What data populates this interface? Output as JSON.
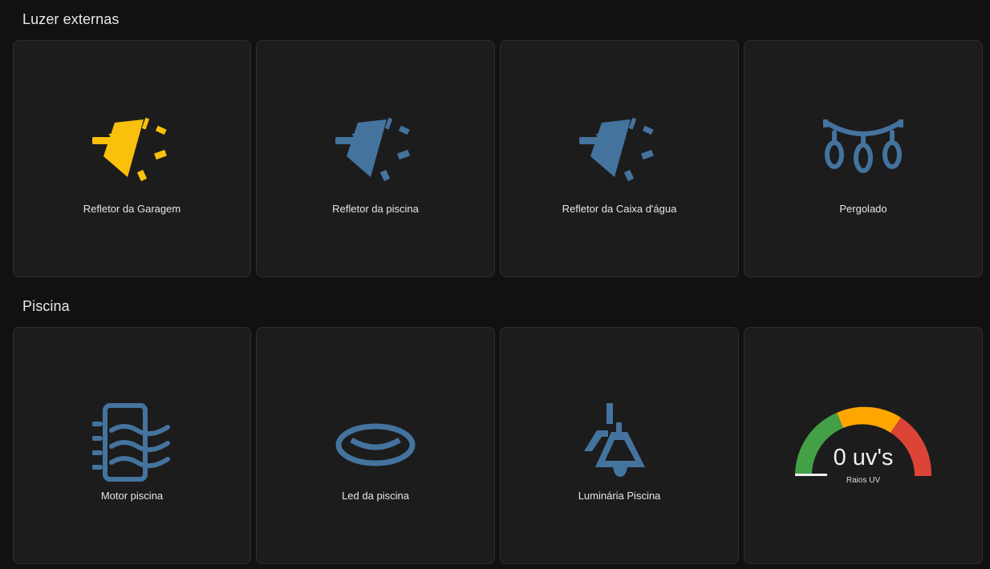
{
  "sections": [
    {
      "title": "Luzer externas",
      "cards": [
        {
          "label": "Refletor da Garagem",
          "icon": "floodlight-icon",
          "state": "on",
          "color": "#f9c00c"
        },
        {
          "label": "Refletor da piscina",
          "icon": "floodlight-icon",
          "state": "off",
          "color": "#44739e"
        },
        {
          "label": "Refletor da Caixa d'água",
          "icon": "floodlight-icon",
          "state": "off",
          "color": "#44739e"
        },
        {
          "label": "Pergolado",
          "icon": "string-lights-icon",
          "state": "off",
          "color": "#44739e"
        }
      ]
    },
    {
      "title": "Piscina",
      "cards": [
        {
          "label": "Motor piscina",
          "icon": "water-pump-icon",
          "state": "off",
          "color": "#44739e"
        },
        {
          "label": "Led da piscina",
          "icon": "ceiling-light-icon",
          "state": "off",
          "color": "#44739e"
        },
        {
          "label": "Luminária Piscina",
          "icon": "pendant-lamp-icon",
          "state": "off",
          "color": "#44739e"
        }
      ],
      "gauge": {
        "value_text": "0 uv's",
        "name": "Raios UV",
        "value": 0,
        "min": 0,
        "max": 11,
        "colors": {
          "green": "#43a047",
          "yellow": "#ffa600",
          "red": "#db4437",
          "track": "#2a2a2a"
        }
      }
    }
  ]
}
